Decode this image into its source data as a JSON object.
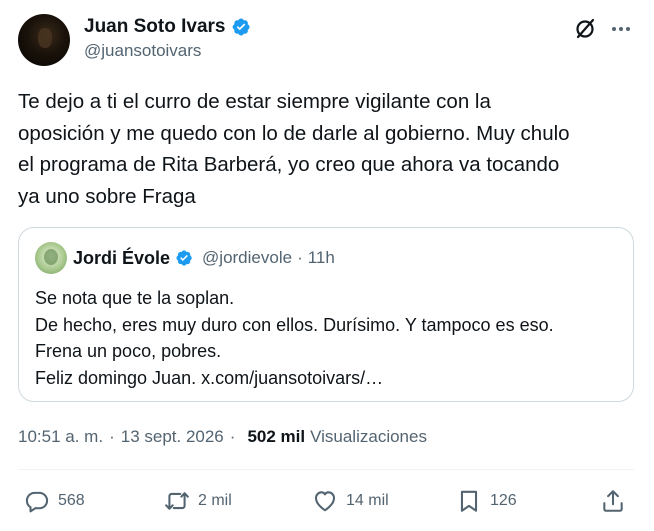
{
  "author": {
    "display_name": "Juan Soto Ivars",
    "handle": "@juansotoivars"
  },
  "tweet": {
    "text_lines": [
      "Te dejo a ti el curro de estar siempre vigilante con la",
      "oposición y me quedo con lo de darle al gobierno. Muy chulo",
      "el programa de Rita Barberá, yo creo que ahora va tocando",
      "ya uno sobre Fraga"
    ]
  },
  "quote": {
    "display_name": "Jordi Évole",
    "handle": "@jordievole",
    "separator": "·",
    "time": "11h",
    "text_lines": [
      "Se nota que te la soplan.",
      "De hecho, eres muy duro con ellos. Durísimo. Y tampoco es eso.",
      "Frena un poco, pobres.",
      "Feliz domingo Juan. x.com/juansotoivars/…"
    ]
  },
  "meta": {
    "time": "10:51 a. m.",
    "separator": "·",
    "date": "13 sept. 2026",
    "views_count": "502 mil",
    "views_label": "Visualizaciones"
  },
  "actions": {
    "replies": "568",
    "reposts": "2 mil",
    "likes": "14 mil",
    "bookmarks": "126"
  },
  "icons": {
    "verified": "verified-badge-icon",
    "grok": "grok-icon",
    "more": "more-icon",
    "reply": "reply-icon",
    "repost": "repost-icon",
    "like": "heart-icon",
    "bookmark": "bookmark-icon",
    "share": "share-icon"
  },
  "colors": {
    "verified_blue": "#1d9bf0",
    "secondary_text": "#536471",
    "primary_text": "#0f1419",
    "border": "#cfd9de"
  }
}
